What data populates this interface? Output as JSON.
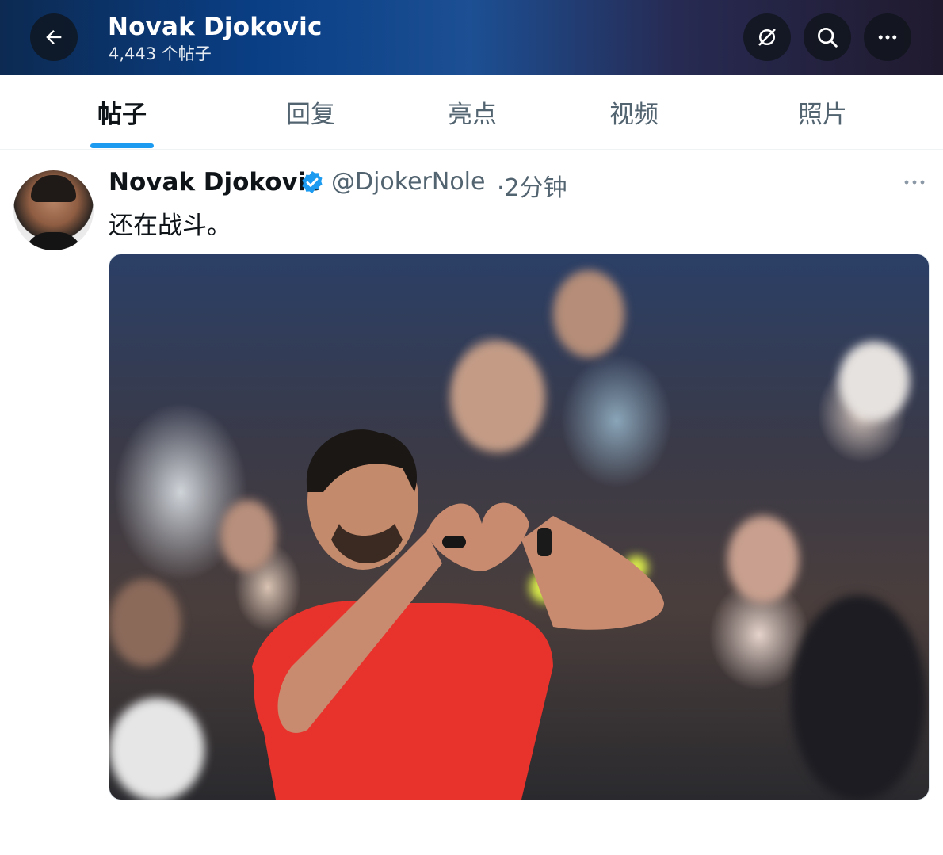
{
  "header": {
    "back_icon": "arrow-left-icon",
    "title": "Novak Djokovic",
    "post_count": "4,443 个帖子",
    "grok_icon": "grok-icon",
    "search_icon": "search-icon",
    "more_icon": "more-horizontal-icon"
  },
  "tabs": [
    {
      "label": "帖子",
      "active": true
    },
    {
      "label": "回复",
      "active": false
    },
    {
      "label": "亮点",
      "active": false
    },
    {
      "label": "视频",
      "active": false
    },
    {
      "label": "照片",
      "active": false
    }
  ],
  "post": {
    "author_name": "Novak Djokovic",
    "verified_icon": "verified-badge-icon",
    "handle": "@DjokerNole",
    "time": "·2分钟",
    "text": "还在战斗。",
    "more_icon": "more-horizontal-icon",
    "photo_icon": "photo-image"
  },
  "colors": {
    "accent": "#1d9bf0",
    "secondary_text": "#536471",
    "primary_text": "#0f1419"
  }
}
